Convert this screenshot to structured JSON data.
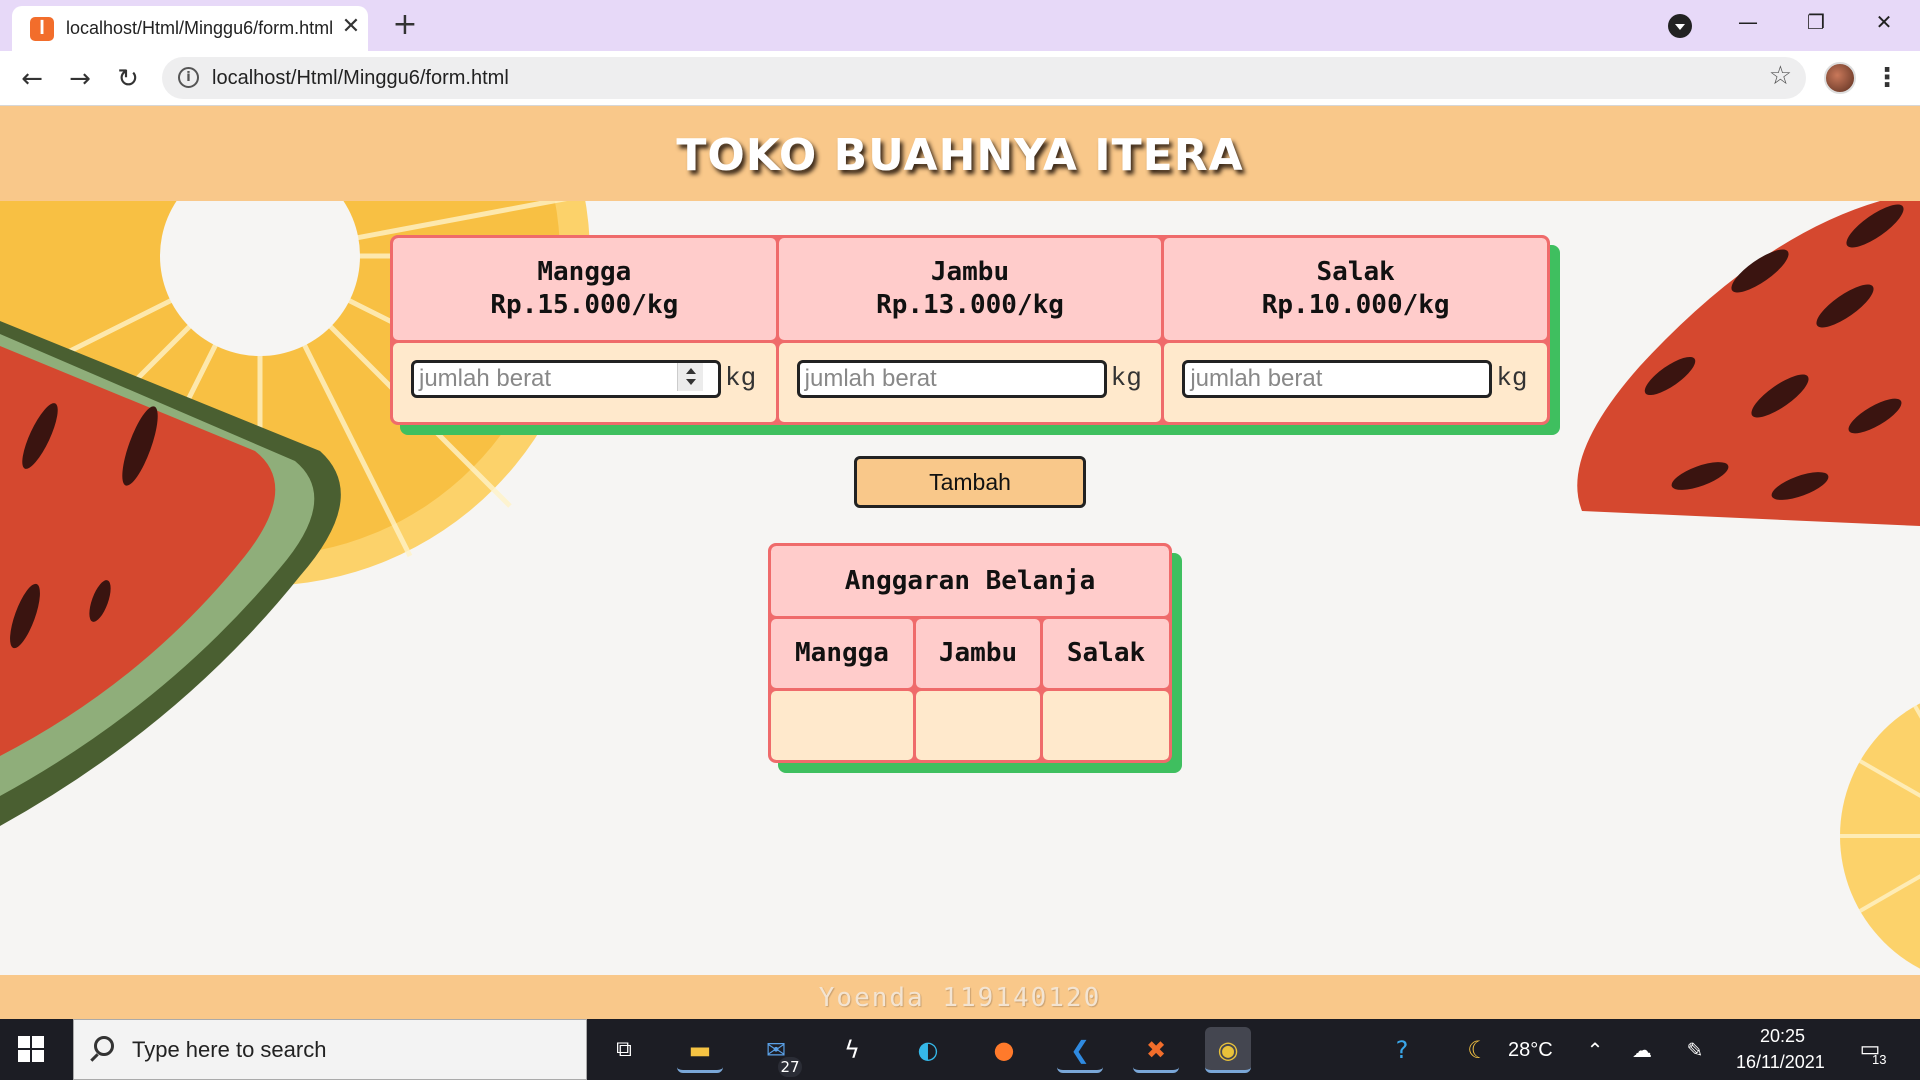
{
  "browser": {
    "tab_title": "localhost/Html/Minggu6/form.html",
    "url": "localhost/Html/Minggu6/form.html",
    "window_controls": {
      "minimize": "—",
      "restore": "❐",
      "close": "✕"
    }
  },
  "page": {
    "title": "TOKO BUAHNYA ITERA",
    "fruits": [
      {
        "name": "Mangga",
        "price": "Rp.15.000/kg",
        "placeholder": "jumlah berat",
        "unit": "kg"
      },
      {
        "name": "Jambu",
        "price": "Rp.13.000/kg",
        "placeholder": "jumlah berat",
        "unit": "kg"
      },
      {
        "name": "Salak",
        "price": "Rp.10.000/kg",
        "placeholder": "jumlah berat",
        "unit": "kg"
      }
    ],
    "add_button": "Tambah",
    "budget": {
      "title": "Anggaran Belanja",
      "columns": [
        "Mangga",
        "Jambu",
        "Salak"
      ],
      "values": [
        "",
        "",
        ""
      ]
    },
    "footer": "Yoenda 119140120"
  },
  "taskbar": {
    "search_placeholder": "Type here to search",
    "mail_badge": "27",
    "temperature": "28°C",
    "time": "20:25",
    "date": "16/11/2021",
    "notifications": "13"
  },
  "colors": {
    "header": "#f9c88a",
    "cell_head": "#ffcccb",
    "cell_body": "#ffe9cc",
    "border": "#ef6b6b",
    "shadow": "#3fbf5f"
  }
}
